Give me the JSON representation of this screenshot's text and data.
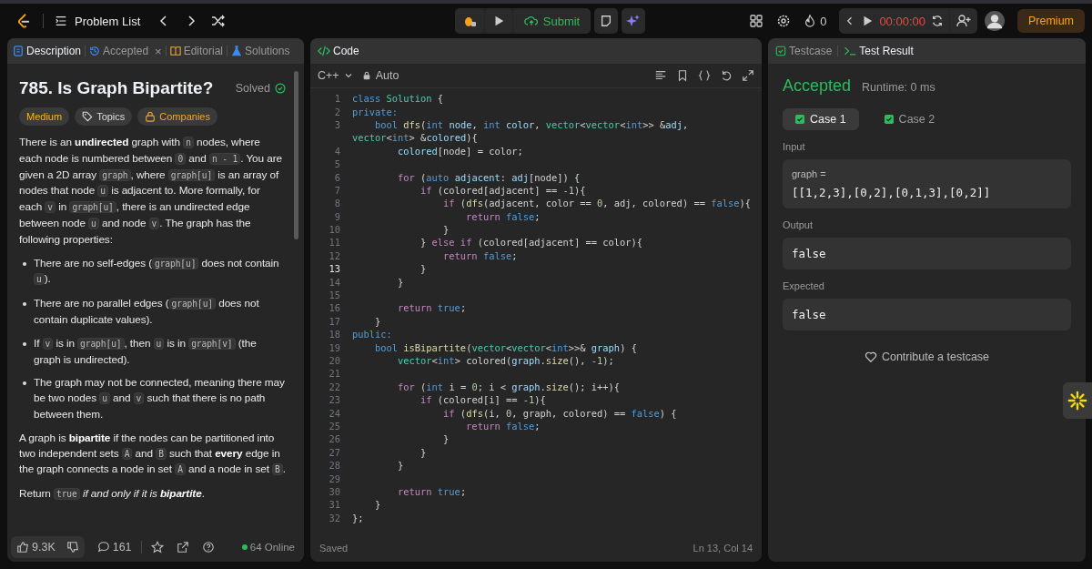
{
  "top_bar": {
    "nav_label": "Problem List",
    "submit": "Submit",
    "streak": "0",
    "timer": "00:00:00",
    "premium": "Premium"
  },
  "left_panel": {
    "tabs": [
      {
        "label": "Description",
        "selected": true
      },
      {
        "label": "Accepted",
        "selected": false,
        "close_glyph": "×"
      },
      {
        "label": "Editorial",
        "selected": false
      },
      {
        "label": "Solutions",
        "selected": false
      }
    ],
    "title": "785. Is Graph Bipartite?",
    "status": "Solved",
    "tags": [
      {
        "label": "Medium",
        "kind": "difficulty"
      },
      {
        "label": "Topics",
        "kind": "topics"
      },
      {
        "label": "Companies",
        "kind": "companies"
      }
    ],
    "description": [
      {
        "kind": "paragraph",
        "segments": [
          {
            "text": "There is an ",
            "kind": "text"
          },
          {
            "text": "undirected",
            "kind": "bold"
          },
          {
            "text": " graph with ",
            "kind": "text"
          },
          {
            "text": "n",
            "kind": "code"
          },
          {
            "text": " nodes, where each node is numbered between ",
            "kind": "text"
          },
          {
            "text": "0",
            "kind": "code"
          },
          {
            "text": " and ",
            "kind": "text"
          },
          {
            "text": "n - 1",
            "kind": "code"
          },
          {
            "text": ". You are given a 2D array ",
            "kind": "text"
          },
          {
            "text": "graph",
            "kind": "code"
          },
          {
            "text": ", where ",
            "kind": "text"
          },
          {
            "text": "graph[u]",
            "kind": "code"
          },
          {
            "text": " is an array of nodes that node ",
            "kind": "text"
          },
          {
            "text": "u",
            "kind": "code"
          },
          {
            "text": " is adjacent to. More formally, for each ",
            "kind": "text"
          },
          {
            "text": "v",
            "kind": "code"
          },
          {
            "text": " in ",
            "kind": "text"
          },
          {
            "text": "graph[u]",
            "kind": "code"
          },
          {
            "text": ", there is an undirected edge between node ",
            "kind": "text"
          },
          {
            "text": "u",
            "kind": "code"
          },
          {
            "text": " and node ",
            "kind": "text"
          },
          {
            "text": "v",
            "kind": "code"
          },
          {
            "text": ". The graph has the following properties:",
            "kind": "text"
          }
        ]
      },
      {
        "kind": "list",
        "items": [
          {
            "segments": [
              {
                "text": "There are no self-edges (",
                "kind": "text"
              },
              {
                "text": "graph[u]",
                "kind": "code"
              },
              {
                "text": " does not contain ",
                "kind": "text"
              },
              {
                "text": "u",
                "kind": "code"
              },
              {
                "text": ").",
                "kind": "text"
              }
            ]
          },
          {
            "segments": [
              {
                "text": "There are no parallel edges (",
                "kind": "text"
              },
              {
                "text": "graph[u]",
                "kind": "code"
              },
              {
                "text": " does not contain duplicate values).",
                "kind": "text"
              }
            ]
          },
          {
            "segments": [
              {
                "text": "If ",
                "kind": "text"
              },
              {
                "text": "v",
                "kind": "code"
              },
              {
                "text": " is in ",
                "kind": "text"
              },
              {
                "text": "graph[u]",
                "kind": "code"
              },
              {
                "text": ", then ",
                "kind": "text"
              },
              {
                "text": "u",
                "kind": "code"
              },
              {
                "text": " is in ",
                "kind": "text"
              },
              {
                "text": "graph[v]",
                "kind": "code"
              },
              {
                "text": " (the graph is undirected).",
                "kind": "text"
              }
            ]
          },
          {
            "segments": [
              {
                "text": "The graph may not be connected, meaning there may be two nodes ",
                "kind": "text"
              },
              {
                "text": "u",
                "kind": "code"
              },
              {
                "text": " and ",
                "kind": "text"
              },
              {
                "text": "v",
                "kind": "code"
              },
              {
                "text": " such that there is no path between them.",
                "kind": "text"
              }
            ]
          }
        ]
      },
      {
        "kind": "paragraph",
        "segments": [
          {
            "text": "A graph is ",
            "kind": "text"
          },
          {
            "text": "bipartite",
            "kind": "bold"
          },
          {
            "text": " if the nodes can be partitioned into two independent sets ",
            "kind": "text"
          },
          {
            "text": "A",
            "kind": "code"
          },
          {
            "text": " and ",
            "kind": "text"
          },
          {
            "text": "B",
            "kind": "code"
          },
          {
            "text": " such that ",
            "kind": "text"
          },
          {
            "text": "every",
            "kind": "bold"
          },
          {
            "text": " edge in the graph connects a node in set ",
            "kind": "text"
          },
          {
            "text": "A",
            "kind": "code"
          },
          {
            "text": " and a node in set ",
            "kind": "text"
          },
          {
            "text": "B",
            "kind": "code"
          },
          {
            "text": ".",
            "kind": "text"
          }
        ]
      },
      {
        "kind": "paragraph",
        "segments": [
          {
            "text": "Return ",
            "kind": "text"
          },
          {
            "text": "true",
            "kind": "code"
          },
          {
            "text": " if and only if it is ",
            "kind": "italic"
          },
          {
            "text": "bipartite",
            "kind": "bold_italic"
          },
          {
            "text": ".",
            "kind": "text"
          }
        ]
      }
    ],
    "footer": {
      "likes": "9.3K",
      "comments": "161",
      "online": "64 Online"
    }
  },
  "editor": {
    "title": "Code",
    "language": "C++",
    "mode": "Auto",
    "status": "Saved",
    "cursor": "Ln 13, Col 14",
    "lines": [
      {
        "number": "1",
        "current": false,
        "segments": [
          {
            "text": "class ",
            "kind": "keyword"
          },
          {
            "text": "Solution",
            "kind": "type"
          },
          {
            "text": " {",
            "kind": "plain"
          }
        ]
      },
      {
        "number": "2",
        "current": false,
        "segments": [
          {
            "text": "private:",
            "kind": "keyword"
          }
        ]
      },
      {
        "number": "3",
        "current": false,
        "segments": [
          {
            "text": "    bool ",
            "kind": "keyword"
          },
          {
            "text": "dfs",
            "kind": "function"
          },
          {
            "text": "(",
            "kind": "plain"
          },
          {
            "text": "int ",
            "kind": "keyword"
          },
          {
            "text": "node",
            "kind": "variable"
          },
          {
            "text": ", ",
            "kind": "plain"
          },
          {
            "text": "int ",
            "kind": "keyword"
          },
          {
            "text": "color",
            "kind": "variable"
          },
          {
            "text": ", ",
            "kind": "plain"
          },
          {
            "text": "vector",
            "kind": "type"
          },
          {
            "text": "<",
            "kind": "plain"
          },
          {
            "text": "vector",
            "kind": "type"
          },
          {
            "text": "<",
            "kind": "plain"
          },
          {
            "text": "int",
            "kind": "keyword"
          },
          {
            "text": ">> &",
            "kind": "plain"
          },
          {
            "text": "adj",
            "kind": "variable"
          },
          {
            "text": ",",
            "kind": "plain"
          }
        ],
        "wrapped": [
          {
            "text": "vector",
            "kind": "type"
          },
          {
            "text": "<",
            "kind": "plain"
          },
          {
            "text": "int",
            "kind": "keyword"
          },
          {
            "text": "> &",
            "kind": "plain"
          },
          {
            "text": "colored",
            "kind": "variable"
          },
          {
            "text": "){",
            "kind": "plain"
          }
        ]
      },
      {
        "number": "4",
        "current": false,
        "segments": [
          {
            "text": "        colored",
            "kind": "variable"
          },
          {
            "text": "[node] = color;",
            "kind": "plain"
          }
        ]
      },
      {
        "number": "5",
        "current": false
      },
      {
        "number": "6",
        "current": false,
        "segments": [
          {
            "text": "        for ",
            "kind": "control"
          },
          {
            "text": "(",
            "kind": "plain"
          },
          {
            "text": "auto ",
            "kind": "keyword"
          },
          {
            "text": "adjacent",
            "kind": "variable"
          },
          {
            "text": ": ",
            "kind": "plain"
          },
          {
            "text": "adj",
            "kind": "variable"
          },
          {
            "text": "[node]) {",
            "kind": "plain"
          }
        ]
      },
      {
        "number": "7",
        "current": false,
        "segments": [
          {
            "text": "            if ",
            "kind": "control"
          },
          {
            "text": "(colored[adjacent] == ",
            "kind": "plain"
          },
          {
            "text": "-1",
            "kind": "number"
          },
          {
            "text": "){",
            "kind": "plain"
          }
        ]
      },
      {
        "number": "8",
        "current": false,
        "segments": [
          {
            "text": "                if ",
            "kind": "control"
          },
          {
            "text": "(",
            "kind": "plain"
          },
          {
            "text": "dfs",
            "kind": "function"
          },
          {
            "text": "(adjacent, color == ",
            "kind": "plain"
          },
          {
            "text": "0",
            "kind": "number"
          },
          {
            "text": ", adj, colored) == ",
            "kind": "plain"
          },
          {
            "text": "false",
            "kind": "keyword"
          },
          {
            "text": "){",
            "kind": "plain"
          }
        ]
      },
      {
        "number": "9",
        "current": false,
        "segments": [
          {
            "text": "                    return ",
            "kind": "control"
          },
          {
            "text": "false",
            "kind": "keyword"
          },
          {
            "text": ";",
            "kind": "plain"
          }
        ]
      },
      {
        "number": "10",
        "current": false,
        "segments": [
          {
            "text": "                }",
            "kind": "plain"
          }
        ]
      },
      {
        "number": "11",
        "current": false,
        "segments": [
          {
            "text": "            } ",
            "kind": "plain"
          },
          {
            "text": "else if ",
            "kind": "control"
          },
          {
            "text": "(colored[adjacent] == color){",
            "kind": "plain"
          }
        ]
      },
      {
        "number": "12",
        "current": false,
        "segments": [
          {
            "text": "                return ",
            "kind": "control"
          },
          {
            "text": "false",
            "kind": "keyword"
          },
          {
            "text": ";",
            "kind": "plain"
          }
        ]
      },
      {
        "number": "13",
        "current": true,
        "segments": [
          {
            "text": "            }",
            "kind": "plain"
          }
        ]
      },
      {
        "number": "14",
        "current": false,
        "segments": [
          {
            "text": "        }",
            "kind": "plain"
          }
        ]
      },
      {
        "number": "15",
        "current": false
      },
      {
        "number": "16",
        "current": false,
        "segments": [
          {
            "text": "        return ",
            "kind": "control"
          },
          {
            "text": "true",
            "kind": "keyword"
          },
          {
            "text": ";",
            "kind": "plain"
          }
        ]
      },
      {
        "number": "17",
        "current": false,
        "segments": [
          {
            "text": "    }",
            "kind": "plain"
          }
        ]
      },
      {
        "number": "18",
        "current": false,
        "segments": [
          {
            "text": "public:",
            "kind": "keyword"
          }
        ]
      },
      {
        "number": "19",
        "current": false,
        "segments": [
          {
            "text": "    bool ",
            "kind": "keyword"
          },
          {
            "text": "isBipartite",
            "kind": "function"
          },
          {
            "text": "(",
            "kind": "plain"
          },
          {
            "text": "vector",
            "kind": "type"
          },
          {
            "text": "<",
            "kind": "plain"
          },
          {
            "text": "vector",
            "kind": "type"
          },
          {
            "text": "<",
            "kind": "plain"
          },
          {
            "text": "int",
            "kind": "keyword"
          },
          {
            "text": ">>& ",
            "kind": "plain"
          },
          {
            "text": "graph",
            "kind": "variable"
          },
          {
            "text": ") {",
            "kind": "plain"
          }
        ]
      },
      {
        "number": "20",
        "current": false,
        "segments": [
          {
            "text": "        vector",
            "kind": "type"
          },
          {
            "text": "<",
            "kind": "plain"
          },
          {
            "text": "int",
            "kind": "keyword"
          },
          {
            "text": "> colored(",
            "kind": "plain"
          },
          {
            "text": "graph",
            "kind": "variable"
          },
          {
            "text": ".",
            "kind": "plain"
          },
          {
            "text": "size",
            "kind": "function"
          },
          {
            "text": "(), ",
            "kind": "plain"
          },
          {
            "text": "-1",
            "kind": "number"
          },
          {
            "text": ");",
            "kind": "plain"
          }
        ]
      },
      {
        "number": "21",
        "current": false
      },
      {
        "number": "22",
        "current": false,
        "segments": [
          {
            "text": "        for ",
            "kind": "control"
          },
          {
            "text": "(",
            "kind": "plain"
          },
          {
            "text": "int ",
            "kind": "keyword"
          },
          {
            "text": "i = ",
            "kind": "plain"
          },
          {
            "text": "0",
            "kind": "number"
          },
          {
            "text": "; i < ",
            "kind": "plain"
          },
          {
            "text": "graph",
            "kind": "variable"
          },
          {
            "text": ".",
            "kind": "plain"
          },
          {
            "text": "size",
            "kind": "function"
          },
          {
            "text": "(); i++){",
            "kind": "plain"
          }
        ]
      },
      {
        "number": "23",
        "current": false,
        "segments": [
          {
            "text": "            if ",
            "kind": "control"
          },
          {
            "text": "(colored[i] == ",
            "kind": "plain"
          },
          {
            "text": "-1",
            "kind": "number"
          },
          {
            "text": "){",
            "kind": "plain"
          }
        ]
      },
      {
        "number": "24",
        "current": false,
        "segments": [
          {
            "text": "                if ",
            "kind": "control"
          },
          {
            "text": "(",
            "kind": "plain"
          },
          {
            "text": "dfs",
            "kind": "function"
          },
          {
            "text": "(i, ",
            "kind": "plain"
          },
          {
            "text": "0",
            "kind": "number"
          },
          {
            "text": ", graph, colored) == ",
            "kind": "plain"
          },
          {
            "text": "false",
            "kind": "keyword"
          },
          {
            "text": ") {",
            "kind": "plain"
          }
        ]
      },
      {
        "number": "25",
        "current": false,
        "segments": [
          {
            "text": "                    return ",
            "kind": "control"
          },
          {
            "text": "false",
            "kind": "keyword"
          },
          {
            "text": ";",
            "kind": "plain"
          }
        ]
      },
      {
        "number": "26",
        "current": false,
        "segments": [
          {
            "text": "                }",
            "kind": "plain"
          }
        ]
      },
      {
        "number": "27",
        "current": false,
        "segments": [
          {
            "text": "            }",
            "kind": "plain"
          }
        ]
      },
      {
        "number": "28",
        "current": false,
        "segments": [
          {
            "text": "        }",
            "kind": "plain"
          }
        ]
      },
      {
        "number": "29",
        "current": false
      },
      {
        "number": "30",
        "current": false,
        "segments": [
          {
            "text": "        return ",
            "kind": "control"
          },
          {
            "text": "true",
            "kind": "keyword"
          },
          {
            "text": ";",
            "kind": "plain"
          }
        ]
      },
      {
        "number": "31",
        "current": false,
        "segments": [
          {
            "text": "    }",
            "kind": "plain"
          }
        ]
      },
      {
        "number": "32",
        "current": false,
        "segments": [
          {
            "text": "};",
            "kind": "plain"
          }
        ]
      }
    ]
  },
  "right_panel": {
    "tabs": [
      {
        "label": "Testcase",
        "selected": false
      },
      {
        "label": "Test Result",
        "selected": true
      }
    ],
    "verdict": "Accepted",
    "runtime": "Runtime: 0 ms",
    "cases": [
      {
        "label": "Case 1",
        "selected": true
      },
      {
        "label": "Case 2",
        "selected": false
      }
    ],
    "sections": [
      {
        "label": "Input",
        "name": "graph =",
        "value": "[[1,2,3],[0,2],[0,1,3],[0,2]]"
      },
      {
        "label": "Output",
        "value": "false"
      },
      {
        "label": "Expected",
        "value": "false"
      }
    ],
    "contribute": "Contribute a testcase"
  }
}
